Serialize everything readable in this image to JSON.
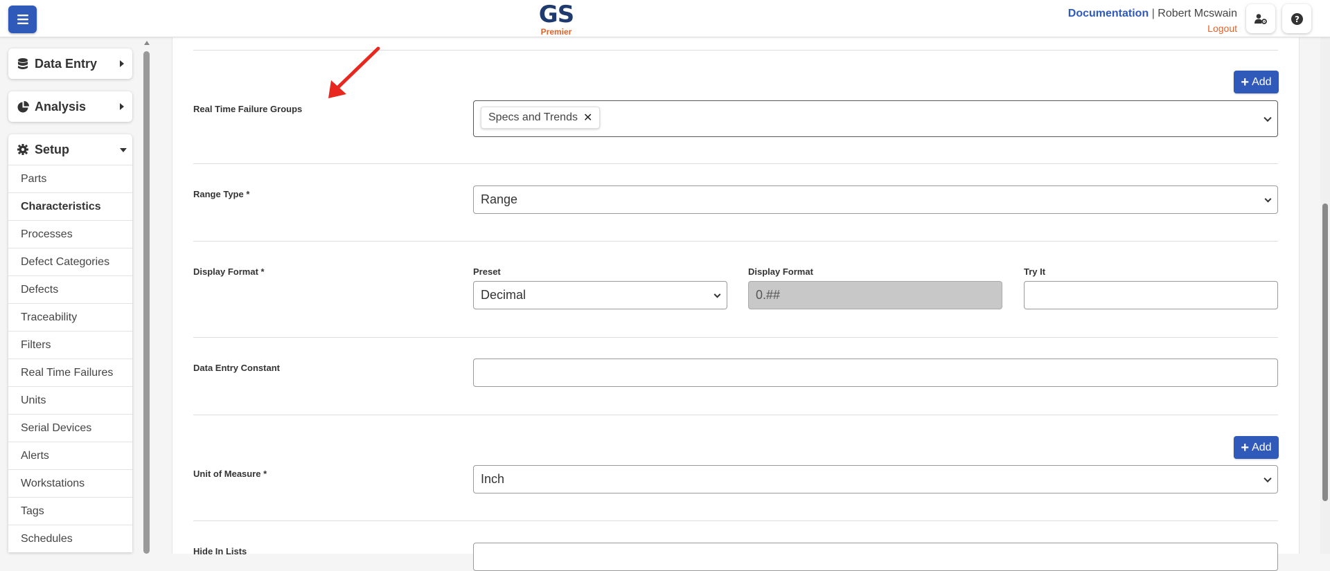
{
  "header": {
    "logo_main": "GS",
    "logo_sub": "Premier",
    "documentation_link": "Documentation",
    "separator": "|",
    "user_name": "Robert Mcswain",
    "logout_link": "Logout",
    "brand_color": "#2f5aba",
    "accent_color": "#e0632a"
  },
  "sidebar": {
    "data_entry": "Data Entry",
    "analysis": "Analysis",
    "setup": "Setup",
    "setup_items": [
      {
        "label": "Parts"
      },
      {
        "label": "Characteristics",
        "active": true
      },
      {
        "label": "Processes"
      },
      {
        "label": "Defect Categories"
      },
      {
        "label": "Defects"
      },
      {
        "label": "Traceability"
      },
      {
        "label": "Filters"
      },
      {
        "label": "Real Time Failures"
      },
      {
        "label": "Units"
      },
      {
        "label": "Serial Devices"
      },
      {
        "label": "Alerts"
      },
      {
        "label": "Workstations"
      },
      {
        "label": "Tags"
      },
      {
        "label": "Schedules"
      }
    ]
  },
  "form": {
    "rtfg": {
      "add_label": "Add",
      "label": "Real Time Failure Groups",
      "selected_tag": "Specs and Trends"
    },
    "range_type": {
      "label": "Range Type *",
      "value": "Range"
    },
    "display_format": {
      "label": "Display Format *",
      "preset_label": "Preset",
      "preset_value": "Decimal",
      "format_label": "Display Format",
      "format_value": "0.##",
      "try_label": "Try It",
      "try_value": ""
    },
    "data_entry_constant": {
      "label": "Data Entry Constant",
      "value": ""
    },
    "unit_of_measure": {
      "add_label": "Add",
      "label": "Unit of Measure *",
      "value": "Inch"
    },
    "hide_in_lists": {
      "label": "Hide In Lists"
    }
  }
}
